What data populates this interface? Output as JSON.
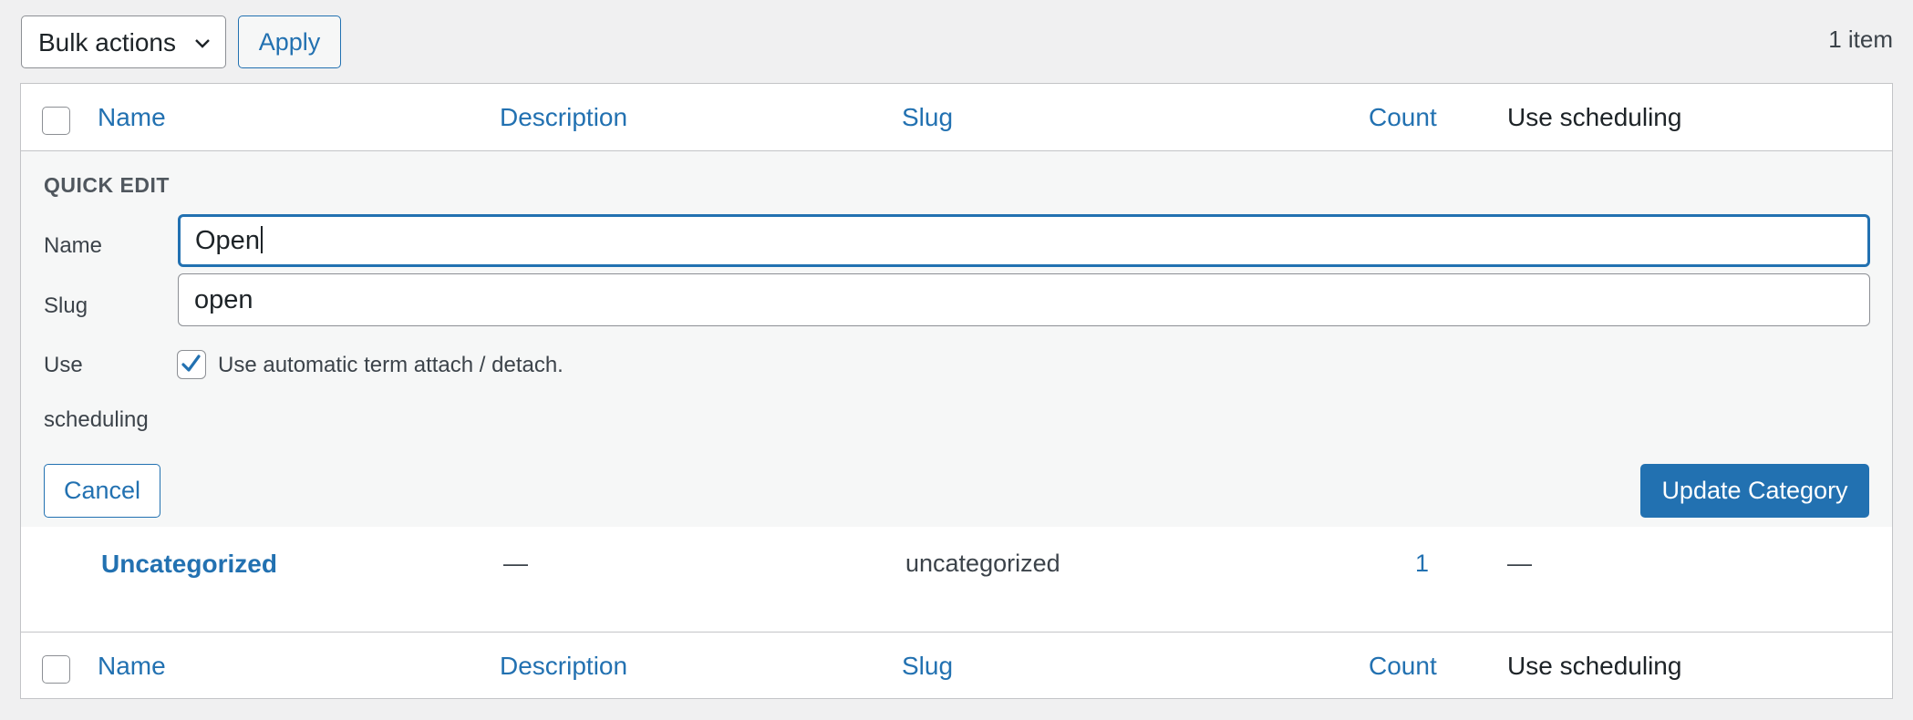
{
  "toolbar": {
    "bulk_actions_label": "Bulk actions",
    "apply_label": "Apply",
    "item_count": "1 item"
  },
  "columns": {
    "name": "Name",
    "description": "Description",
    "slug": "Slug",
    "count": "Count",
    "use_scheduling": "Use scheduling"
  },
  "quick_edit": {
    "title": "QUICK EDIT",
    "name_label": "Name",
    "name_value": "Open",
    "slug_label": "Slug",
    "slug_value": "open",
    "use_label": "Use",
    "scheduling_label": "scheduling",
    "checkbox_checked": true,
    "checkbox_label": "Use automatic term attach / detach.",
    "cancel_label": "Cancel",
    "update_label": "Update Category"
  },
  "rows": [
    {
      "name": "Uncategorized",
      "description": "—",
      "slug": "uncategorized",
      "count": "1",
      "use_scheduling": "—"
    }
  ],
  "colors": {
    "accent": "#2271b1",
    "background": "#f0f0f1",
    "border": "#c3c4c7"
  },
  "icons": {
    "bulk_dropdown": "chevron-down-icon",
    "checkbox_mark": "checkmark-icon"
  }
}
